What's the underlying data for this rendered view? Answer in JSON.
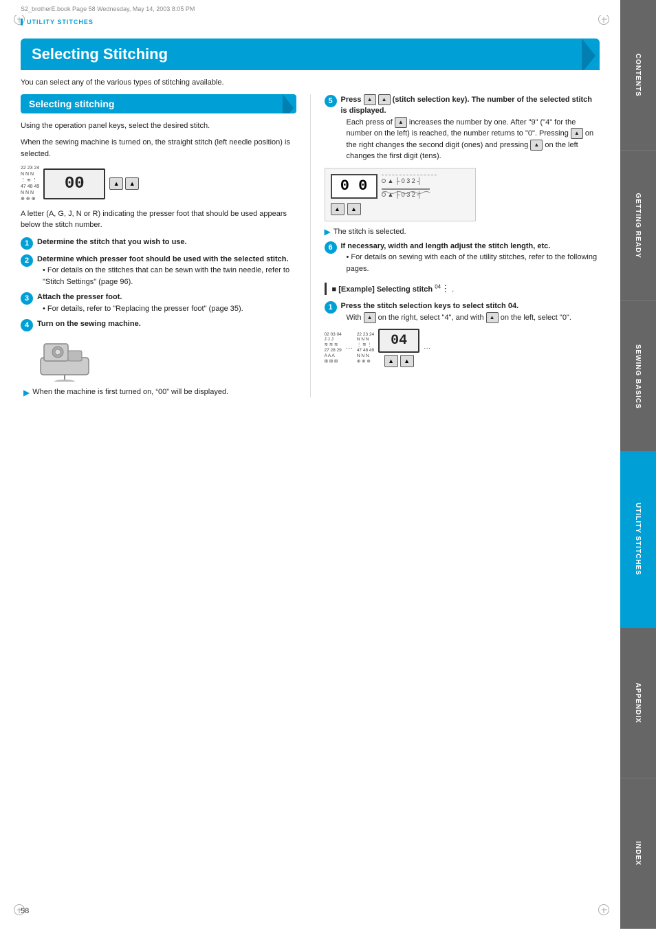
{
  "page": {
    "filename": "S2_brotherE.book  Page 58  Wednesday, May 14, 2003  8:05 PM",
    "number": "58",
    "section_label": "UTILITY STITCHES",
    "title": "Selecting Stitching",
    "subtitle": "Selecting stitching",
    "intro": "You can select any of the various types of stitching available.",
    "sub_intro1": "Using the operation panel keys, select the desired stitch.",
    "sub_intro2": "When the sewing machine is turned on, the straight stitch (left needle position) is selected.",
    "sub_intro3": "A letter (A, G, J, N or R) indicating the presser foot that should be used appears below the stitch number."
  },
  "sidebar": {
    "tabs": [
      {
        "id": "contents",
        "label": "CONTENTS",
        "color": "#666"
      },
      {
        "id": "getting-ready",
        "label": "GETTING READY",
        "color": "#666"
      },
      {
        "id": "sewing-basics",
        "label": "SEWING BASICS",
        "color": "#666"
      },
      {
        "id": "utility-stitches",
        "label": "UTILITY STITCHES",
        "color": "#00a0d6"
      },
      {
        "id": "appendix",
        "label": "APPENDIX",
        "color": "#666"
      },
      {
        "id": "index",
        "label": "INDEX",
        "color": "#666"
      }
    ]
  },
  "steps_left": [
    {
      "number": "1",
      "text": "Determine the stitch that you wish to use."
    },
    {
      "number": "2",
      "text": "Determine which presser foot should be used with the selected stitch.",
      "bullet": "For details on the stitches that can be sewn with the twin needle, refer to “Stitch Settings” (page 96)."
    },
    {
      "number": "3",
      "text": "Attach the presser foot.",
      "bullet": "For details, refer to “Replacing the presser foot” (page 35)."
    },
    {
      "number": "4",
      "text": "Turn on the sewing machine."
    }
  ],
  "step4_result": "When the machine is first turned on, “00” will be displayed.",
  "steps_right": [
    {
      "number": "5",
      "text": "Press ▲ ▲ (stitch selection key). The number of the selected stitch is displayed.",
      "detail": "Each press of ▲ increases the number by one. After “9” (“4” for the number on the left) is reached, the number returns to “0”. Pressing ▲ on the right changes the second digit (ones) and pressing ▲ on the left changes the first digit (tens)."
    },
    {
      "number": "5_result",
      "text": "The stitch is selected."
    },
    {
      "number": "6",
      "text": "If necessary, width and length adjust the stitch length, etc.",
      "bullet": "For details on sewing with each of the utility stitches, refer to the following pages."
    }
  ],
  "example": {
    "title": "[Example] Selecting stitch",
    "stitch_num": "04",
    "step": {
      "number": "1",
      "text": "Press the stitch selection keys to select stitch 04.",
      "detail": "With ▲ on the right, select “4”, and with ▲ on the left, select “0”."
    }
  },
  "display": {
    "default": "00",
    "example": "04"
  }
}
